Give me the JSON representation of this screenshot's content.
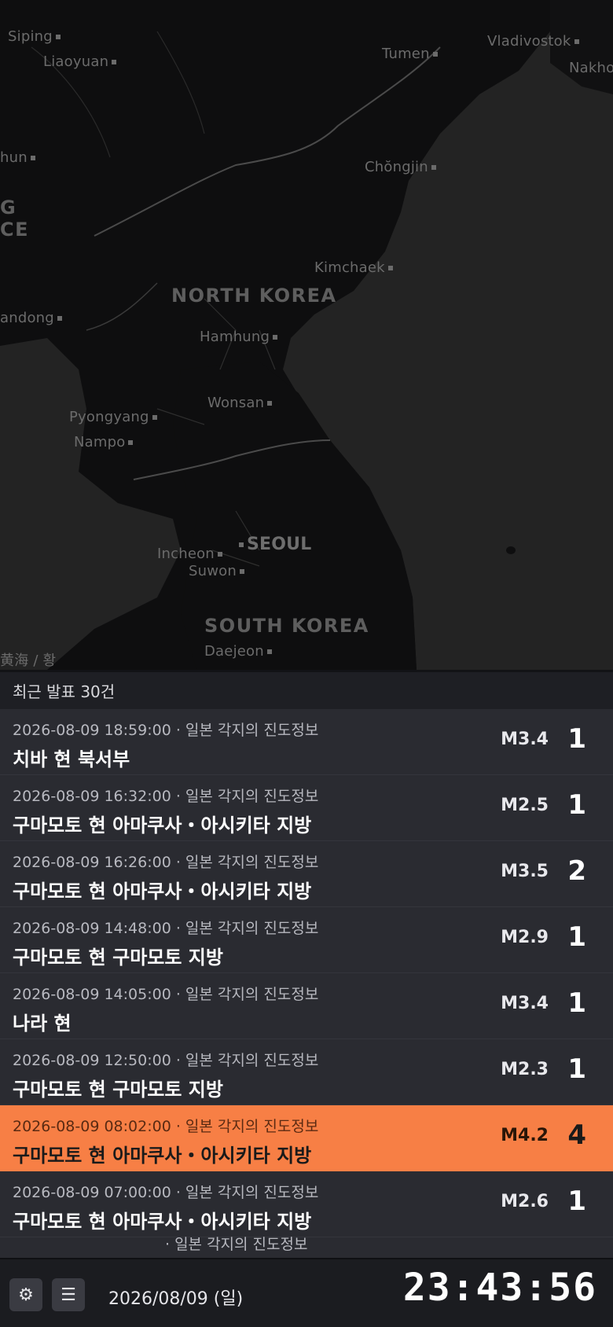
{
  "map": {
    "labels": {
      "siping": "Siping",
      "liaoyuan": "Liaoyuan",
      "tumen": "Tumen",
      "vladivostok": "Vladivostok",
      "nakhodka": "Nakho",
      "chongjin": "Chŏngjin",
      "hun": "hun",
      "g": "G",
      "ce": "CE",
      "kimchaek": "Kimchaek",
      "north_korea": "NORTH KOREA",
      "dandong": "andong",
      "hamhung": "Hamhung",
      "wonsan": "Wonsan",
      "pyongyang": "Pyongyang",
      "nampo": "Nampo",
      "seoul": "SEOUL",
      "incheon": "Incheon",
      "suwon": "Suwon",
      "south_korea": "SOUTH KOREA",
      "yellow_sea": "黄海 / 황",
      "daejeon": "Daejeon"
    }
  },
  "list": {
    "header": "최근 발표 30건",
    "items": [
      {
        "time": "2026-08-09 18:59:00",
        "type": "일본 각지의 진도정보",
        "location": "치바 현 북서부",
        "magnitude": "M3.4",
        "shindo": "1",
        "highlight": false
      },
      {
        "time": "2026-08-09 16:32:00",
        "type": "일본 각지의 진도정보",
        "location": "구마모토 현 아마쿠사・아시키타 지방",
        "magnitude": "M2.5",
        "shindo": "1",
        "highlight": false
      },
      {
        "time": "2026-08-09 16:26:00",
        "type": "일본 각지의 진도정보",
        "location": "구마모토 현 아마쿠사・아시키타 지방",
        "magnitude": "M3.5",
        "shindo": "2",
        "highlight": false
      },
      {
        "time": "2026-08-09 14:48:00",
        "type": "일본 각지의 진도정보",
        "location": "구마모토 현 구마모토 지방",
        "magnitude": "M2.9",
        "shindo": "1",
        "highlight": false
      },
      {
        "time": "2026-08-09 14:05:00",
        "type": "일본 각지의 진도정보",
        "location": "나라 현",
        "magnitude": "M3.4",
        "shindo": "1",
        "highlight": false
      },
      {
        "time": "2026-08-09 12:50:00",
        "type": "일본 각지의 진도정보",
        "location": "구마모토 현 구마모토 지방",
        "magnitude": "M2.3",
        "shindo": "1",
        "highlight": false
      },
      {
        "time": "2026-08-09 08:02:00",
        "type": "일본 각지의 진도정보",
        "location": "구마모토 현 아마쿠사・아시키타 지방",
        "magnitude": "M4.2",
        "shindo": "4",
        "highlight": true
      },
      {
        "time": "2026-08-09 07:00:00",
        "type": "일본 각지의 진도정보",
        "location": "구마모토 현 아마쿠사・아시키타 지방",
        "magnitude": "M2.6",
        "shindo": "1",
        "highlight": false
      }
    ],
    "partial_row_meta": "· 일본 각지의 진도정보"
  },
  "footer": {
    "settings_icon": "gear-icon",
    "settings_glyph": "⚙",
    "menu_icon": "menu-icon",
    "menu_glyph": "☰",
    "date": "2026/08/09 (일)",
    "clock": "23:43:56"
  },
  "colors": {
    "highlight": "#f77f45",
    "row_bg": "#2a2b31",
    "footer_bg": "#1b1c20"
  }
}
